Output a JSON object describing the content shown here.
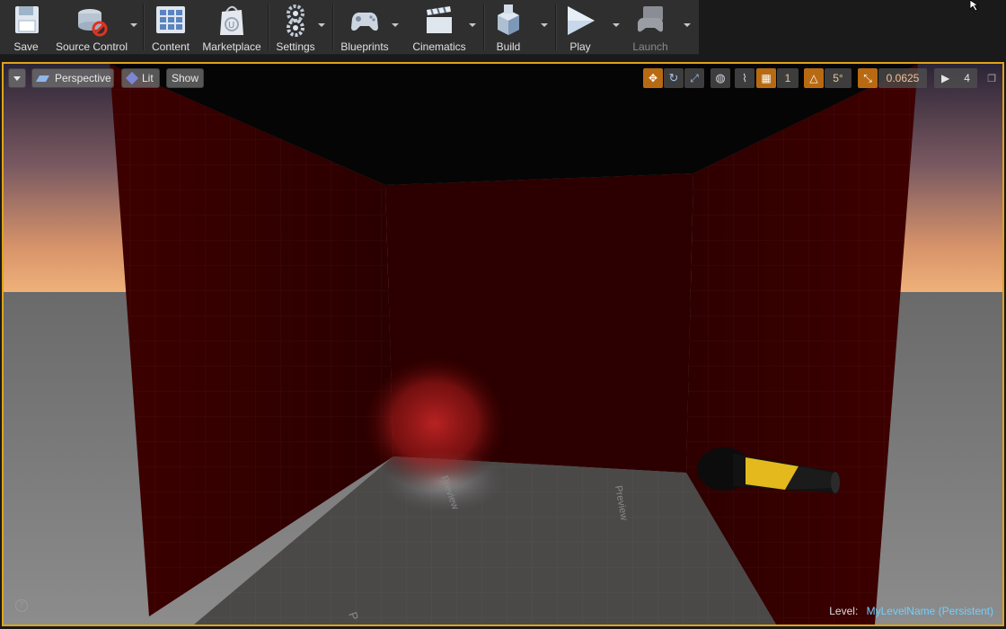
{
  "toolbar": {
    "save": "Save",
    "source_control": "Source Control",
    "content": "Content",
    "marketplace": "Marketplace",
    "settings": "Settings",
    "blueprints": "Blueprints",
    "cinematics": "Cinematics",
    "build": "Build",
    "play": "Play",
    "launch": "Launch"
  },
  "viewport": {
    "perspective": "Perspective",
    "lit": "Lit",
    "show": "Show",
    "grid_snap_value": "1",
    "rotation_snap_value": "5°",
    "scale_snap_value": "0.0625",
    "camera_speed_value": "4",
    "level_label": "Level:",
    "level_name": "MyLevelName (Persistent)",
    "floor_text_1": "Preview",
    "floor_text_2": "Preview",
    "floor_text_3": "P"
  },
  "colors": {
    "selection_border": "#e0a21e",
    "wall_red": "#3a0000",
    "level_name": "#6fd0ff"
  }
}
